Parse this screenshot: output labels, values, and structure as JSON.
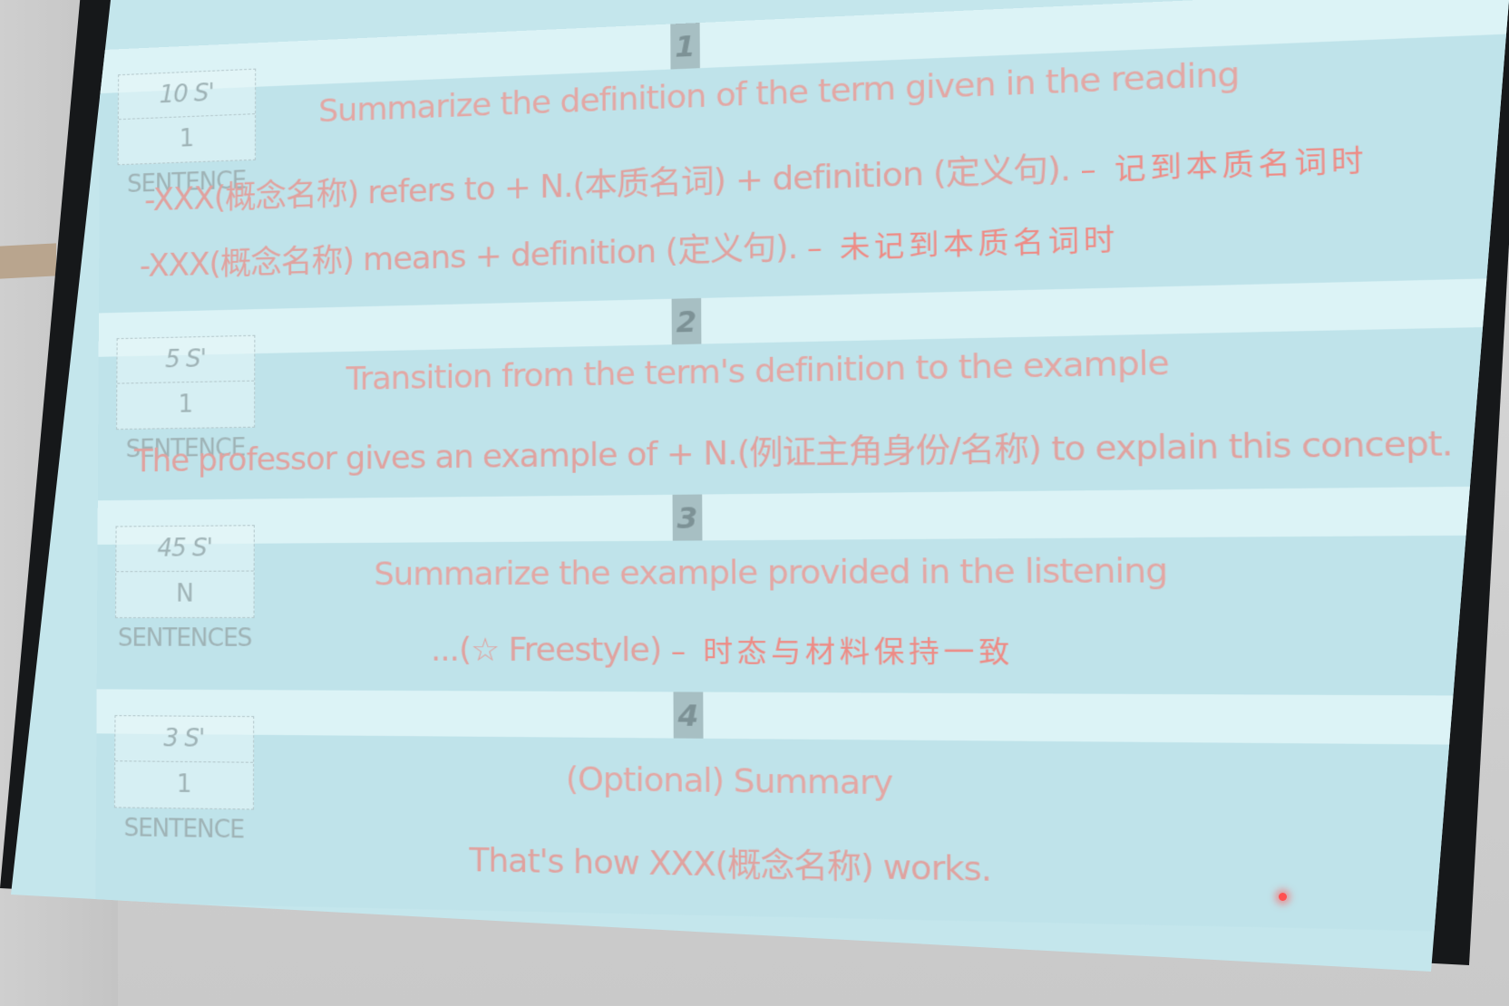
{
  "slide": {
    "sections": [
      {
        "number": "1",
        "time": "10 S'",
        "count": "1 SENTENCE",
        "headline": "Summarize the definition of the term given in the reading",
        "lines": [
          {
            "text": "-XXX(概念名称) refers to + N.(本质名词) + definition (定义句).",
            "note": "– 记到本质名词时"
          },
          {
            "text": "-XXX(概念名称) means + definition (定义句).",
            "note": "– 未记到本质名词时"
          }
        ]
      },
      {
        "number": "2",
        "time": "5 S'",
        "count": "1 SENTENCE",
        "headline": "Transition from the term's definition to the example",
        "lines": [
          {
            "text": "The professor gives an example of + N.(例证主角身份/名称) to explain this concept.",
            "note": ""
          }
        ]
      },
      {
        "number": "3",
        "time": "45 S'",
        "count": "N SENTENCES",
        "headline": "Summarize the example provided in the listening",
        "lines": [
          {
            "text": "...(☆ Freestyle)",
            "note": "– 时态与材料保持一致"
          }
        ]
      },
      {
        "number": "4",
        "time": "3 S'",
        "count": "1 SENTENCE",
        "headline": "(Optional) Summary",
        "lines": [
          {
            "text": "That's how XXX(概念名称) works.",
            "note": ""
          }
        ]
      }
    ]
  }
}
